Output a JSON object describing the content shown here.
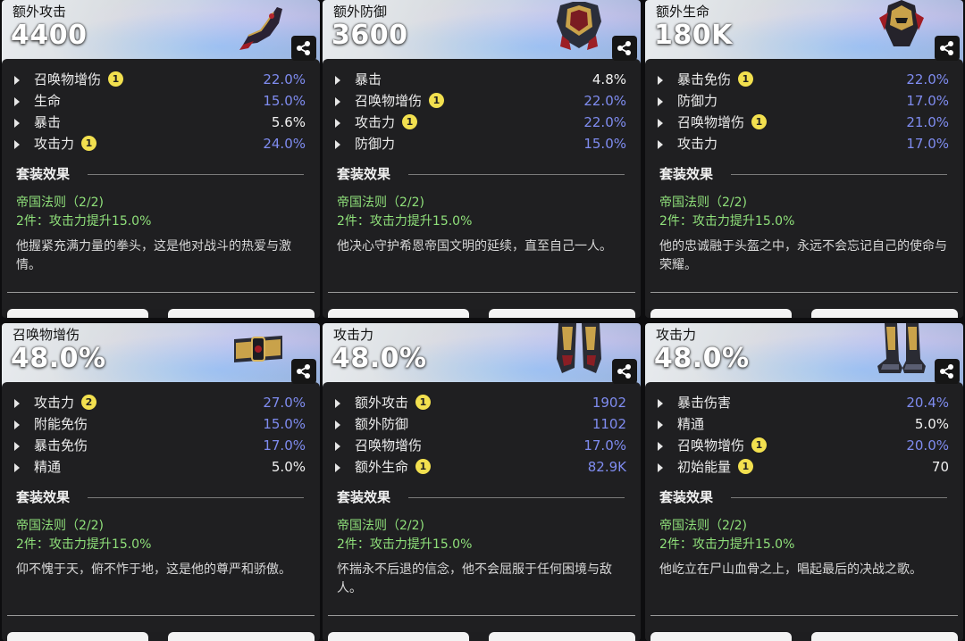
{
  "set_effect_title": "套装效果",
  "cards": [
    {
      "label": "额外攻击",
      "value": "4400",
      "icon": "gauntlet-icon",
      "stats": [
        {
          "name": "召唤物增伤",
          "badge": "1",
          "value": "22.0%",
          "color": "blue"
        },
        {
          "name": "生命",
          "badge": "",
          "value": "15.0%",
          "color": "blue"
        },
        {
          "name": "暴击",
          "badge": "",
          "value": "5.6%",
          "color": "white"
        },
        {
          "name": "攻击力",
          "badge": "1",
          "value": "24.0%",
          "color": "blue"
        }
      ],
      "set_name": "帝国法则（2/2)",
      "set_bonus": "2件：攻击力提升15.0%",
      "flavor": "他握紧充满力量的拳头，这是他对战斗的热爱与激情。"
    },
    {
      "label": "额外防御",
      "value": "3600",
      "icon": "chest-armor-icon",
      "stats": [
        {
          "name": "暴击",
          "badge": "",
          "value": "4.8%",
          "color": "white"
        },
        {
          "name": "召唤物增伤",
          "badge": "1",
          "value": "22.0%",
          "color": "blue"
        },
        {
          "name": "攻击力",
          "badge": "1",
          "value": "22.0%",
          "color": "blue"
        },
        {
          "name": "防御力",
          "badge": "",
          "value": "15.0%",
          "color": "blue"
        }
      ],
      "set_name": "帝国法则（2/2)",
      "set_bonus": "2件：攻击力提升15.0%",
      "flavor": "他决心守护希恩帝国文明的延续，直至自己一人。"
    },
    {
      "label": "额外生命",
      "value": "180K",
      "icon": "helmet-icon",
      "stats": [
        {
          "name": "暴击免伤",
          "badge": "1",
          "value": "22.0%",
          "color": "blue"
        },
        {
          "name": "防御力",
          "badge": "",
          "value": "17.0%",
          "color": "blue"
        },
        {
          "name": "召唤物增伤",
          "badge": "1",
          "value": "21.0%",
          "color": "blue"
        },
        {
          "name": "攻击力",
          "badge": "",
          "value": "17.0%",
          "color": "blue"
        }
      ],
      "set_name": "帝国法则（2/2)",
      "set_bonus": "2件：攻击力提升15.0%",
      "flavor": "他的忠诚融于头盔之中，永远不会忘记自己的使命与荣耀。"
    },
    {
      "label": "召唤物增伤",
      "value": "48.0%",
      "icon": "belt-icon",
      "stats": [
        {
          "name": "攻击力",
          "badge": "2",
          "value": "27.0%",
          "color": "blue"
        },
        {
          "name": "附能免伤",
          "badge": "",
          "value": "15.0%",
          "color": "blue"
        },
        {
          "name": "暴击免伤",
          "badge": "",
          "value": "17.0%",
          "color": "blue"
        },
        {
          "name": "精通",
          "badge": "",
          "value": "5.0%",
          "color": "white"
        }
      ],
      "set_name": "帝国法则（2/2)",
      "set_bonus": "2件：攻击力提升15.0%",
      "flavor": "仰不愧于天，俯不怍于地，这是他的尊严和骄傲。"
    },
    {
      "label": "攻击力",
      "value": "48.0%",
      "icon": "leg-armor-icon",
      "stats": [
        {
          "name": "额外攻击",
          "badge": "1",
          "value": "1902",
          "color": "blue"
        },
        {
          "name": "额外防御",
          "badge": "",
          "value": "1102",
          "color": "blue"
        },
        {
          "name": "召唤物增伤",
          "badge": "",
          "value": "17.0%",
          "color": "blue"
        },
        {
          "name": "额外生命",
          "badge": "1",
          "value": "82.9K",
          "color": "blue"
        }
      ],
      "set_name": "帝国法则（2/2)",
      "set_bonus": "2件：攻击力提升15.0%",
      "flavor": "怀揣永不后退的信念，他不会屈服于任何困境与敌人。"
    },
    {
      "label": "攻击力",
      "value": "48.0%",
      "icon": "boots-icon",
      "stats": [
        {
          "name": "暴击伤害",
          "badge": "",
          "value": "20.4%",
          "color": "blue"
        },
        {
          "name": "精通",
          "badge": "",
          "value": "5.0%",
          "color": "white"
        },
        {
          "name": "召唤物增伤",
          "badge": "1",
          "value": "20.0%",
          "color": "blue"
        },
        {
          "name": "初始能量",
          "badge": "1",
          "value": "70",
          "color": "white"
        }
      ],
      "set_name": "帝国法则（2/2)",
      "set_bonus": "2件：攻击力提升15.0%",
      "flavor": "他屹立在尸山血骨之上，唱起最后的决战之歌。"
    }
  ]
}
